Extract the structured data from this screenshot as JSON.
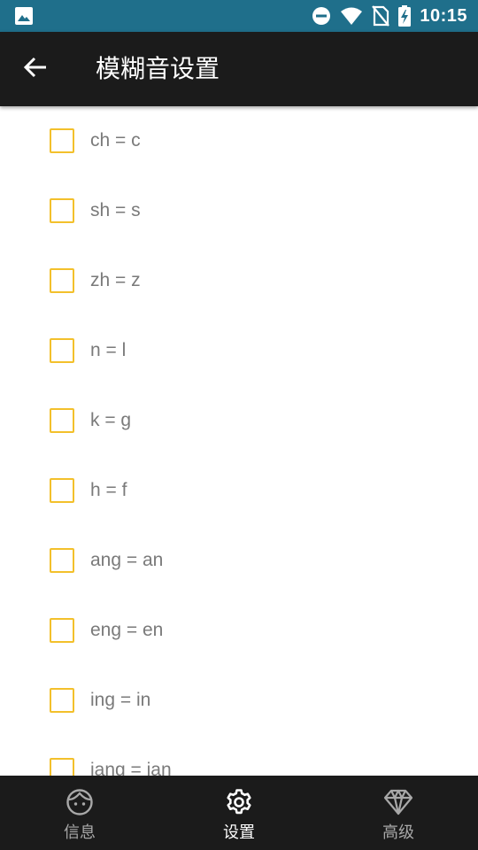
{
  "status_bar": {
    "time": "10:15",
    "icons": [
      "image-icon",
      "do-not-disturb-icon",
      "wifi-icon",
      "no-sim-icon",
      "battery-charging-icon"
    ],
    "background_color": "#1f6f8b"
  },
  "app_bar": {
    "back_icon": "arrow-left-icon",
    "title": "模糊音设置",
    "background_color": "#1b1b1b"
  },
  "options": [
    {
      "label": "ch = c",
      "checked": false
    },
    {
      "label": "sh = s",
      "checked": false
    },
    {
      "label": "zh = z",
      "checked": false
    },
    {
      "label": "n = l",
      "checked": false
    },
    {
      "label": "k = g",
      "checked": false
    },
    {
      "label": "h = f",
      "checked": false
    },
    {
      "label": "ang = an",
      "checked": false
    },
    {
      "label": "eng = en",
      "checked": false
    },
    {
      "label": "ing = in",
      "checked": false
    },
    {
      "label": "iang = ian",
      "checked": false
    }
  ],
  "checkbox_color": "#f3c02b",
  "bottom_nav": {
    "items": [
      {
        "label": "信息",
        "icon": "face-icon",
        "active": false
      },
      {
        "label": "设置",
        "icon": "gear-icon",
        "active": true
      },
      {
        "label": "高级",
        "icon": "diamond-icon",
        "active": false
      }
    ]
  }
}
